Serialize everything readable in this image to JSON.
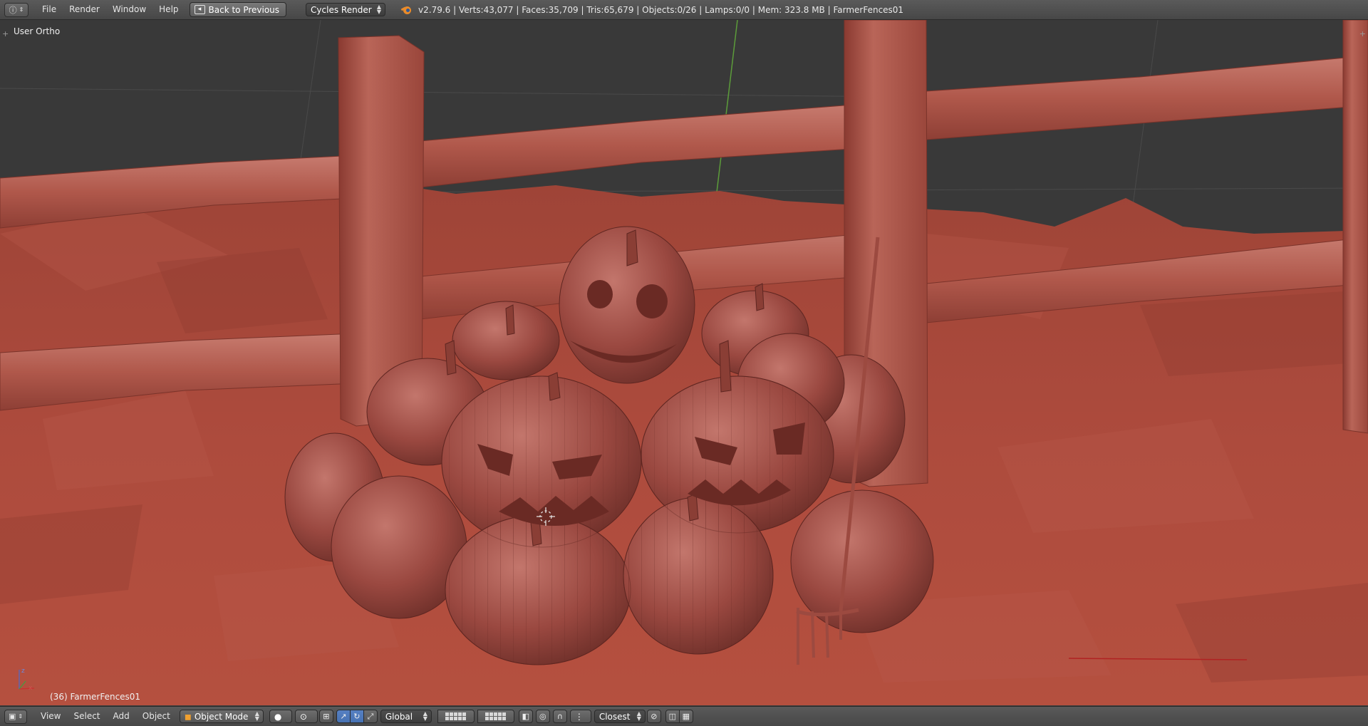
{
  "header": {
    "menus": [
      "File",
      "Render",
      "Window",
      "Help"
    ],
    "back_button": "Back to Previous",
    "render_engine": "Cycles Render",
    "stats": "v2.79.6 | Verts:43,077 | Faces:35,709 | Tris:65,679 | Objects:0/26 | Lamps:0/0 | Mem: 323.8 MB | FarmerFences01"
  },
  "viewport": {
    "view_label": "User Ortho",
    "object_label": "(36) FarmerFences01"
  },
  "footer": {
    "menus": [
      "View",
      "Select",
      "Add",
      "Object"
    ],
    "mode": "Object Mode",
    "transform_orientation": "Global",
    "snap_target": "Closest"
  },
  "colors": {
    "header_bg": "#4f4f4f",
    "viewport_bg": "#393939",
    "terrain": "#a94a3c",
    "pumpkin": "#9c4a42",
    "accent_blue": "#5680c2"
  }
}
